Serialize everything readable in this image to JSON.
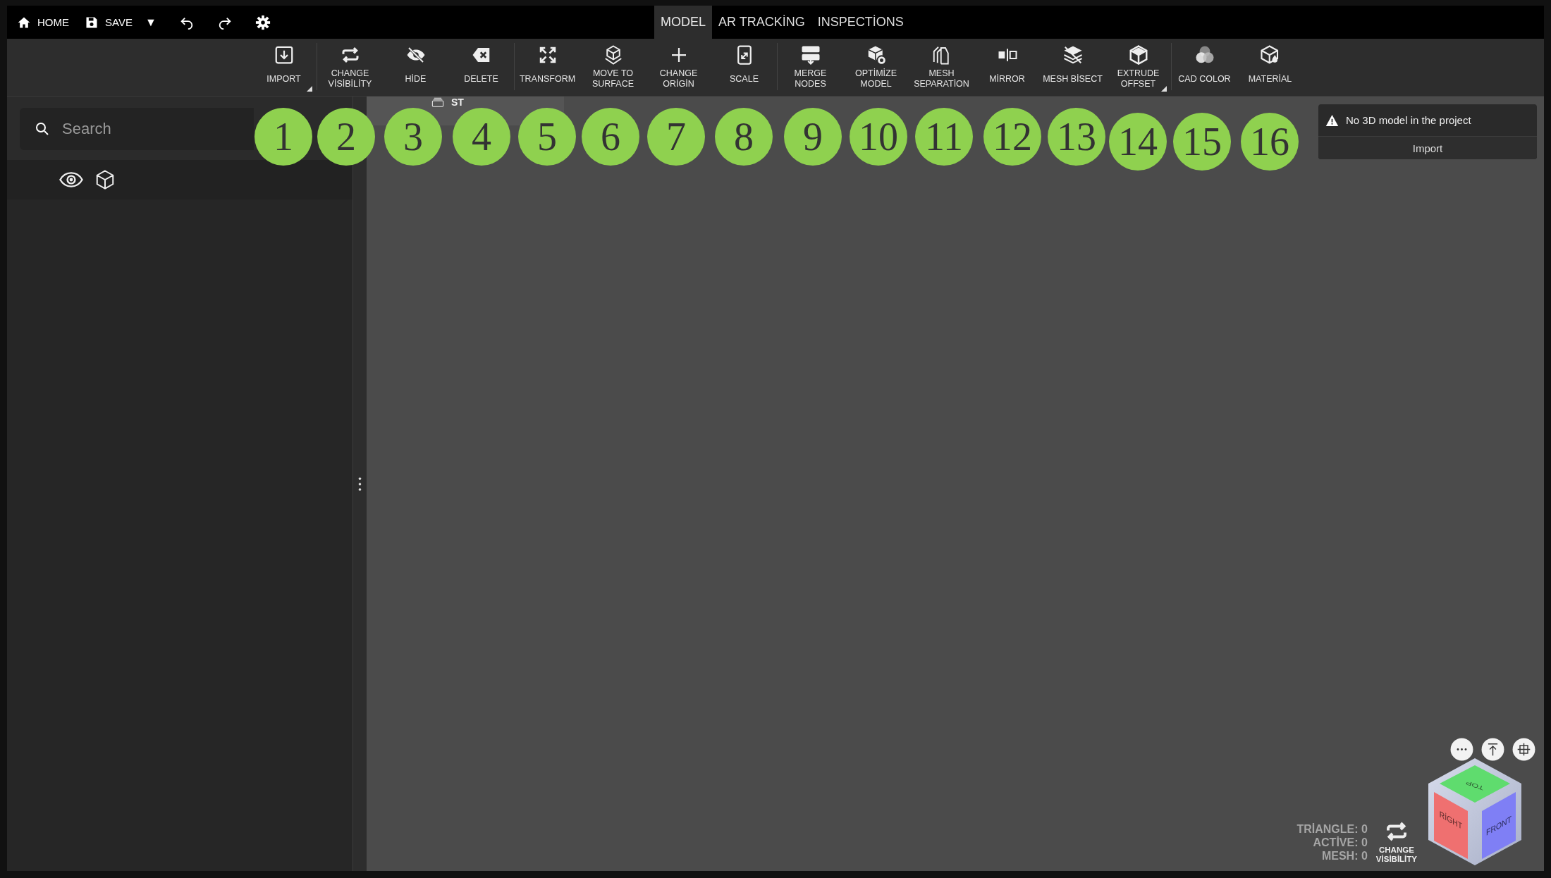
{
  "topbar": {
    "buttons": [
      {
        "kind": "home",
        "label": "HOME"
      },
      {
        "kind": "save",
        "label": "SAVE"
      },
      {
        "kind": "dropdown",
        "label": "▼"
      },
      {
        "kind": "undo"
      },
      {
        "kind": "redo"
      },
      {
        "kind": "settings"
      }
    ]
  },
  "tabs": [
    {
      "label": "MODEL",
      "selected": true
    },
    {
      "label": "AR TRACKİNG",
      "selected": false
    },
    {
      "label": "INSPECTİONS",
      "selected": false
    }
  ],
  "toolbar": {
    "groups": [
      [
        {
          "kind": "import",
          "lines": [
            "IMPORT"
          ],
          "has_menu": true
        }
      ],
      [
        {
          "kind": "visibility",
          "lines": [
            "CHANGE",
            "VİSİBİLİTY"
          ],
          "has_menu": false
        },
        {
          "kind": "hide",
          "lines": [
            "HİDE"
          ],
          "has_menu": false
        },
        {
          "kind": "delete",
          "lines": [
            "DELETE"
          ],
          "has_menu": false
        }
      ],
      [
        {
          "kind": "transform",
          "lines": [
            "TRANSFORM"
          ],
          "has_menu": false
        },
        {
          "kind": "surface",
          "lines": [
            "MOVE TO",
            "SURFACE"
          ],
          "has_menu": false
        },
        {
          "kind": "origin",
          "lines": [
            "CHANGE",
            "ORİGİN"
          ],
          "has_menu": false
        },
        {
          "kind": "scale",
          "lines": [
            "SCALE"
          ],
          "has_menu": false
        }
      ],
      [
        {
          "kind": "merge",
          "lines": [
            "MERGE",
            "NODES"
          ],
          "has_menu": false
        },
        {
          "kind": "optimize",
          "lines": [
            "OPTİMİZE",
            "MODEL"
          ],
          "has_menu": false
        },
        {
          "kind": "separation",
          "lines": [
            "MESH",
            "SEPARATİON"
          ],
          "has_menu": false
        },
        {
          "kind": "mirror",
          "lines": [
            "MİRROR"
          ],
          "has_menu": false
        },
        {
          "kind": "bisect",
          "lines": [
            "MESH BİSECT"
          ],
          "has_menu": false
        },
        {
          "kind": "extrude",
          "lines": [
            "EXTRUDE",
            "OFFSET"
          ],
          "has_menu": true
        }
      ],
      [
        {
          "kind": "color",
          "lines": [
            "CAD COLOR"
          ],
          "has_menu": false
        },
        {
          "kind": "material",
          "lines": [
            "MATERİAL"
          ],
          "has_menu": false
        }
      ]
    ]
  },
  "annotations": [
    "1",
    "2",
    "3",
    "4",
    "5",
    "6",
    "7",
    "8",
    "9",
    "10",
    "11",
    "12",
    "13",
    "14",
    "15",
    "16"
  ],
  "sidebar": {
    "search": {
      "placeholder": "Search"
    },
    "items": [
      {
        "kind": "model",
        "visible": true
      }
    ]
  },
  "viewport": {
    "tabs": [
      {
        "label": "ST"
      }
    ]
  },
  "notice": {
    "message": "No 3D model in the project",
    "action": "Import"
  },
  "stats": [
    "TRİANGLE: 0",
    "ACTİVE: 0",
    "MESH: 0"
  ],
  "visibility_toggle": {
    "lines": [
      "CHANGE",
      "VİSİBİLİTY"
    ]
  },
  "view_buttons": [
    {
      "kind": "more"
    },
    {
      "kind": "top"
    },
    {
      "kind": "center"
    }
  ],
  "view_cube": {
    "faces": [
      {
        "kind": "top",
        "label": "TOP"
      },
      {
        "kind": "right",
        "label": "RİGHT"
      },
      {
        "kind": "front",
        "label": "FRONT"
      }
    ]
  }
}
